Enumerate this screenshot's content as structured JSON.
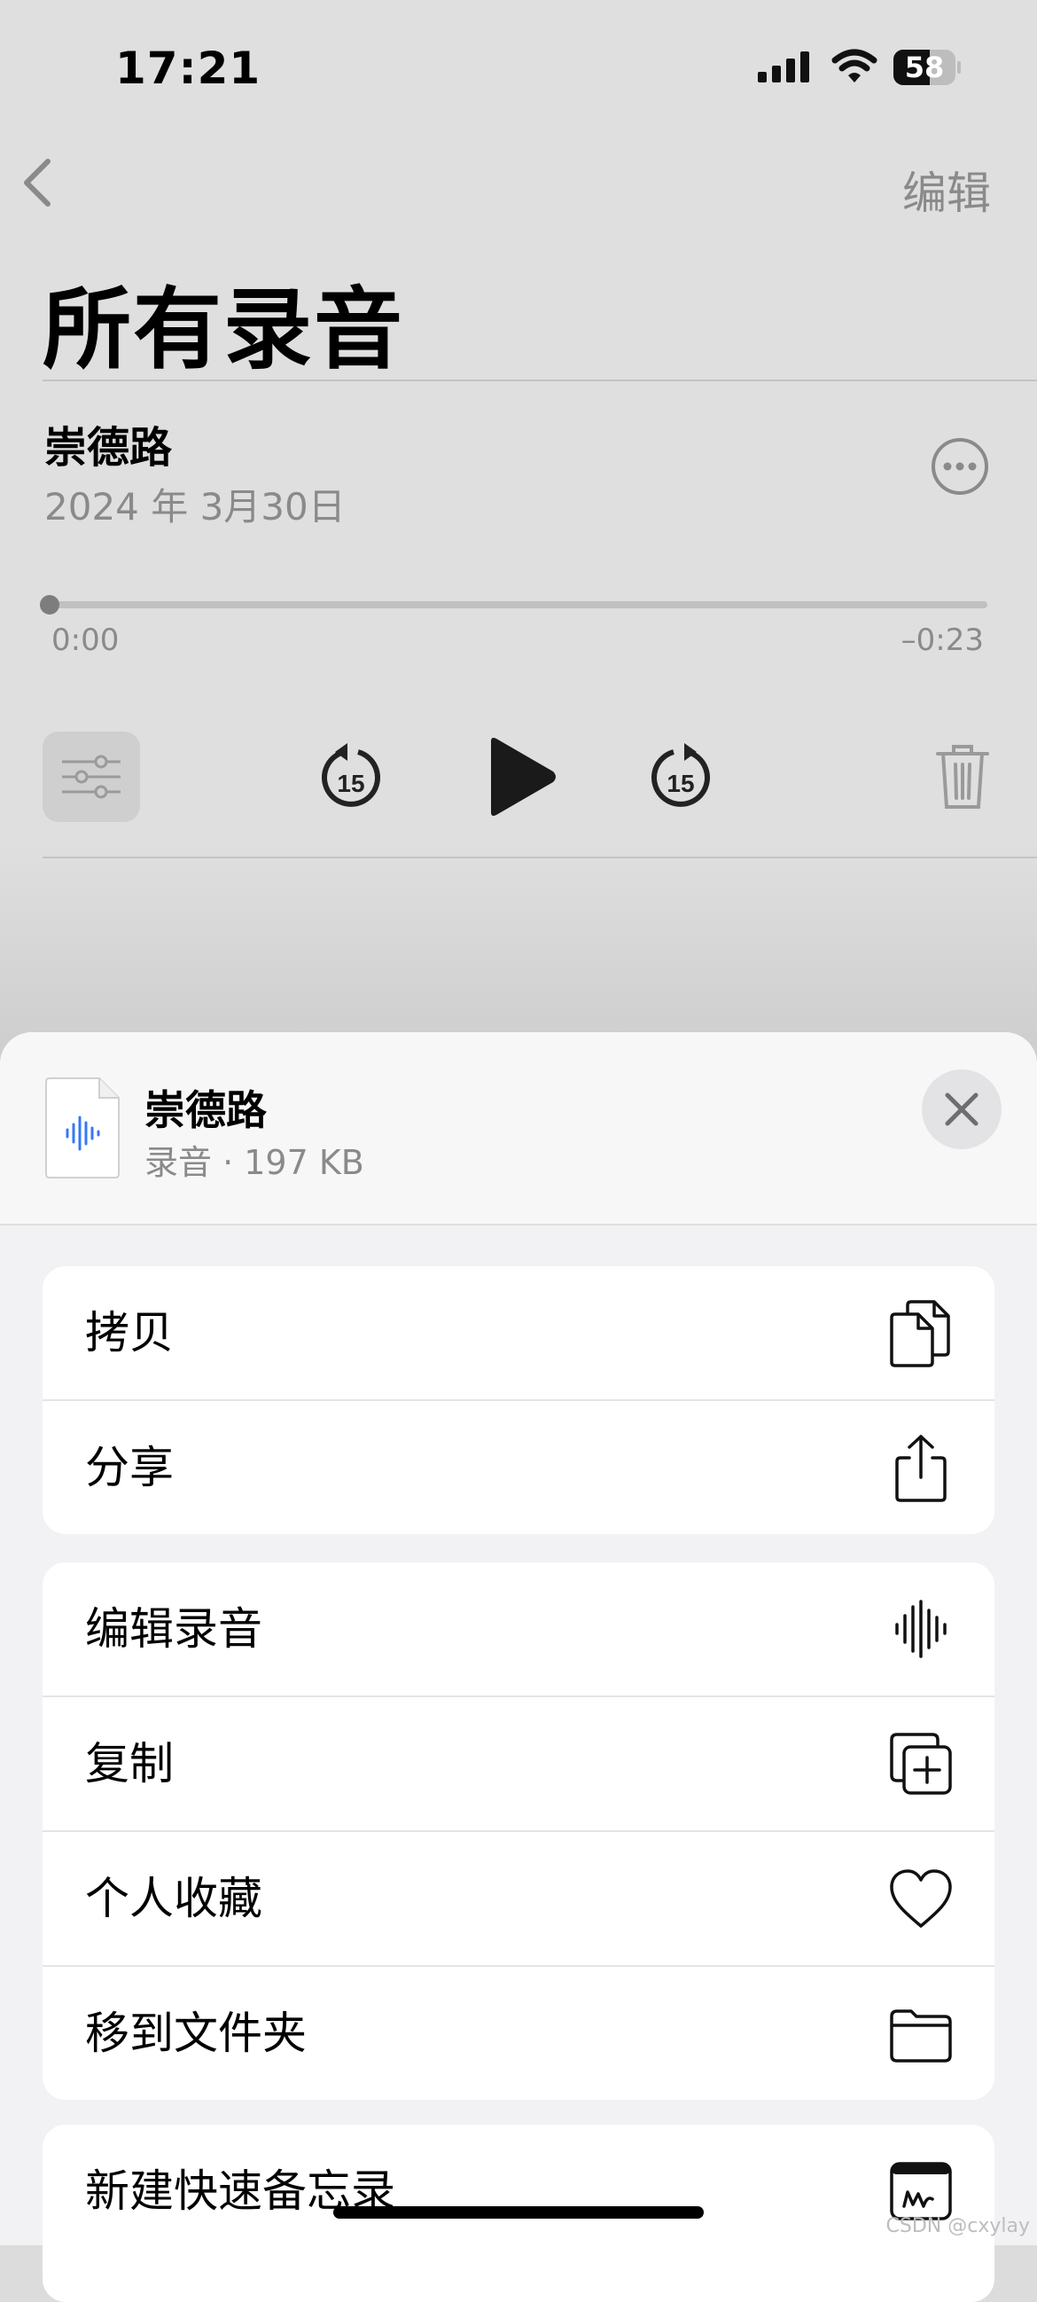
{
  "status_bar": {
    "time": "17:21",
    "battery": "58",
    "battery_level": 0.58
  },
  "nav": {
    "edit": "编辑"
  },
  "page": {
    "title": "所有录音"
  },
  "recording": {
    "title": "崇德路",
    "date": "2024 年 3月30日",
    "progress": 0,
    "elapsed": "0:00",
    "remaining": "–0:23",
    "skip_seconds": "15"
  },
  "sheet": {
    "title": "崇德路",
    "subtitle": "录音 · 197 KB",
    "groups": [
      [
        {
          "label": "拷贝",
          "icon": "copy-icon"
        },
        {
          "label": "分享",
          "icon": "share-icon"
        }
      ],
      [
        {
          "label": "编辑录音",
          "icon": "waveform-icon"
        },
        {
          "label": "复制",
          "icon": "duplicate-icon"
        },
        {
          "label": "个人收藏",
          "icon": "heart-icon"
        },
        {
          "label": "移到文件夹",
          "icon": "folder-icon"
        }
      ],
      [
        {
          "label": "新建快速备忘录",
          "icon": "quick-note-icon"
        }
      ]
    ]
  },
  "watermark": "CSDN @cxylay",
  "colors": {
    "accent_blue": "#3478f6",
    "secondary_text": "#8a8a8a"
  }
}
